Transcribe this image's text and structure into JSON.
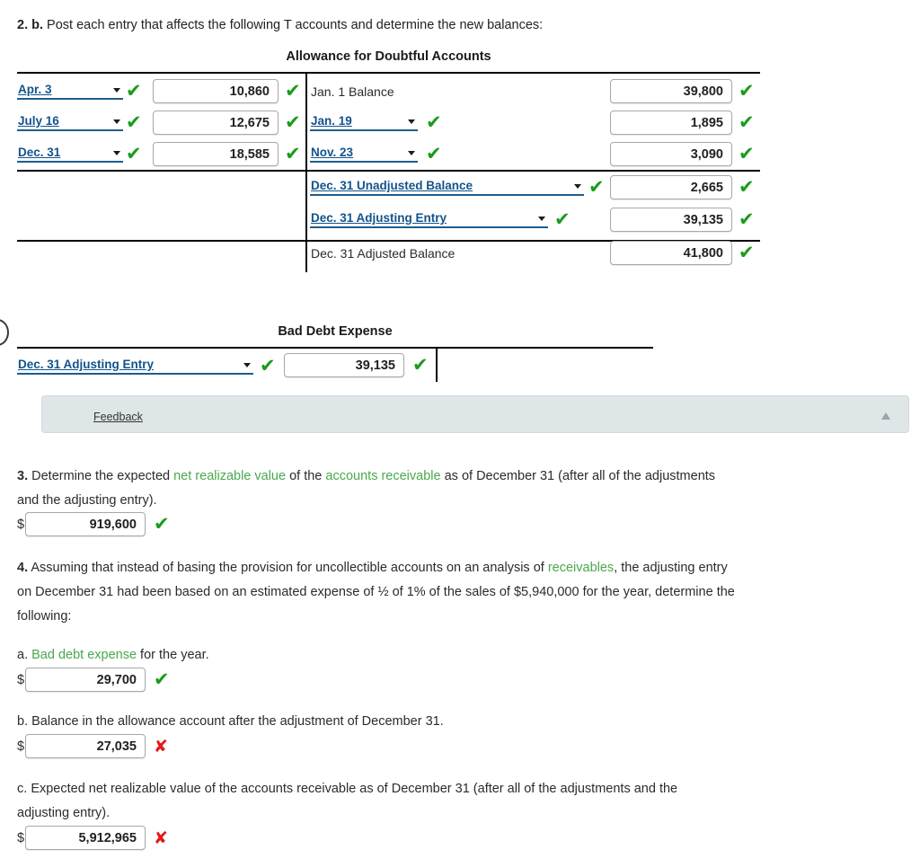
{
  "question_2b": {
    "number": "2. b.",
    "text": "Post each entry that affects the following T accounts and determine the new balances:"
  },
  "allowance_account": {
    "title": "Allowance for Doubtful Accounts",
    "debit_rows": [
      {
        "label": "Apr. 3",
        "label_type": "select",
        "label_check": "✔",
        "amount": "10,860",
        "amount_check": "✔"
      },
      {
        "label": "July 16",
        "label_type": "select",
        "label_check": "✔",
        "amount": "12,675",
        "amount_check": "✔"
      },
      {
        "label": "Dec. 31",
        "label_type": "select",
        "label_check": "✔",
        "amount": "18,585",
        "amount_check": "✔"
      }
    ],
    "credit_rows": [
      {
        "label": "Jan. 1 Balance",
        "label_type": "static",
        "label_check": "",
        "amount": "39,800",
        "amount_check": "✔"
      },
      {
        "label": "Jan. 19",
        "label_type": "select",
        "label_check": "✔",
        "amount": "1,895",
        "amount_check": "✔"
      },
      {
        "label": "Nov. 23",
        "label_type": "select",
        "label_check": "✔",
        "amount": "3,090",
        "amount_check": "✔"
      },
      {
        "label": "Dec. 31 Unadjusted Balance",
        "label_type": "select",
        "label_check": "✔",
        "amount": "2,665",
        "amount_check": "✔"
      },
      {
        "label": "Dec. 31 Adjusting Entry",
        "label_type": "select",
        "label_check": "✔",
        "amount": "39,135",
        "amount_check": "✔"
      },
      {
        "label": "Dec. 31 Adjusted Balance",
        "label_type": "static",
        "label_check": "",
        "amount": "41,800",
        "amount_check": "✔"
      }
    ]
  },
  "bad_debt_account": {
    "title": "Bad Debt Expense",
    "rows": [
      {
        "label": "Dec. 31 Adjusting Entry",
        "label_type": "select",
        "label_check": "✔",
        "amount": "39,135",
        "amount_check": "✔"
      }
    ]
  },
  "feedback": {
    "label": "Feedback",
    "collapse_icon": "▲"
  },
  "question_3": {
    "number": "3.",
    "line1_a": "Determine the expected ",
    "term1": "net realizable value",
    "line1_b": " of the ",
    "term2": "accounts receivable",
    "line1_c": " as of December 31 (after all of the adjustments",
    "line2": "and the adjusting entry).",
    "currency": "$",
    "answer": "919,600",
    "check": "✔"
  },
  "question_4": {
    "number": "4.",
    "line1_a": "Assuming that instead of basing the provision for uncollectible accounts on an analysis of ",
    "term1": "receivables",
    "line1_b": ", the adjusting entry",
    "line2": "on December 31 had been based on an estimated expense of ½ of 1% of the sales of $5,940,000 for the year, determine the",
    "line3": "following:",
    "parts": [
      {
        "letter": "a.",
        "text_a": "",
        "term": "Bad debt expense",
        "text_b": " for the year.",
        "currency": "$",
        "answer": "29,700",
        "mark": "✔",
        "mark_state": "ok"
      },
      {
        "letter": "b.",
        "text_a": "Balance in the allowance account after the adjustment of December 31.",
        "term": "",
        "text_b": "",
        "currency": "$",
        "answer": "27,035",
        "mark": "✘",
        "mark_state": "no"
      },
      {
        "letter": "c.",
        "text_a": "Expected net realizable value of the accounts receivable as of December 31 (after all of the adjustments and the",
        "text_a2": "adjusting entry).",
        "term": "",
        "text_b": "",
        "currency": "$",
        "answer": "5,912,965",
        "mark": "✘",
        "mark_state": "no"
      }
    ]
  },
  "colors": {
    "accent_link": "#12538c",
    "glossary": "#49a84c",
    "correct": "#1a9c1a",
    "incorrect": "#e01b1b",
    "feedback_bg": "#dfe6e8"
  }
}
